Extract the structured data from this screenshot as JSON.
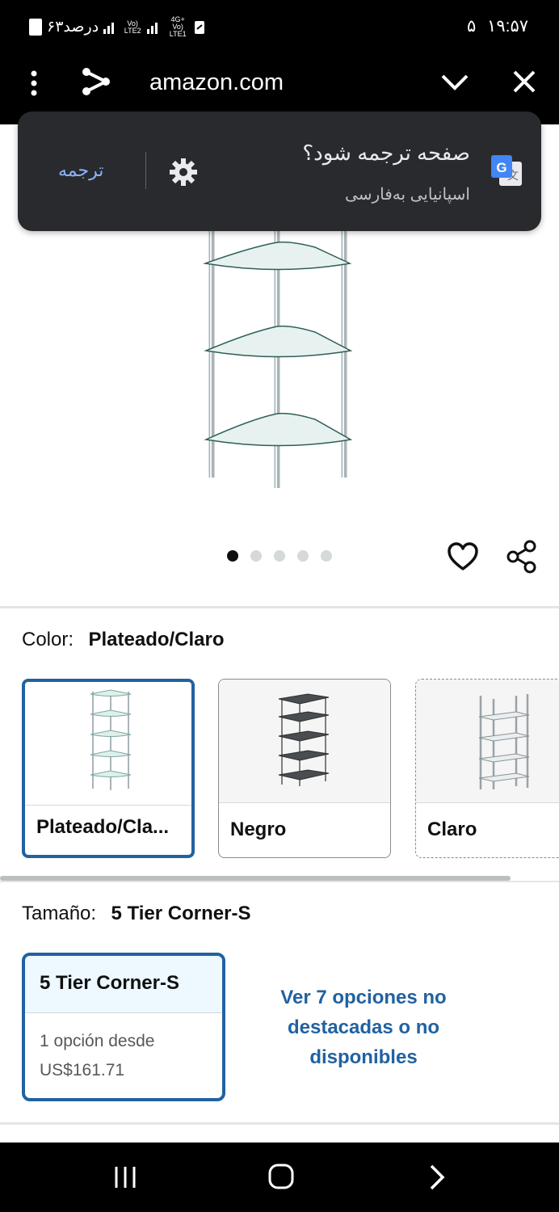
{
  "status_bar": {
    "time": "۱۹:۵۷",
    "notification_count": "۵",
    "battery": "۶۳درصد",
    "network_1": "Vo) LTE2",
    "network_2": "4G+ Vo) LTE1"
  },
  "browser": {
    "url": "amazon.com"
  },
  "translate_popup": {
    "title": "صفحه ترجمه شود؟",
    "subtitle": "اسپانیایی به‌فارسی",
    "translate_button": "ترجمه"
  },
  "gallery": {
    "dot_count": 5,
    "active_index": 0
  },
  "color_section": {
    "label": "Color:",
    "value": "Plateado/Claro",
    "options": [
      {
        "name": "Plateado/Cla..."
      },
      {
        "name": "Negro"
      },
      {
        "name": "Claro"
      }
    ]
  },
  "size_section": {
    "label": "Tamaño:",
    "value": "5 Tier Corner-S",
    "card": {
      "title": "5 Tier Corner-S",
      "line1": "1 opción desde",
      "line2": "US$161.71"
    },
    "more_options": "Ver 7 opciones no destacadas o no disponibles"
  },
  "colors": {
    "accent": "#2162a1",
    "popup_bg": "#292a2d",
    "translate_link": "#8ab4f8"
  }
}
